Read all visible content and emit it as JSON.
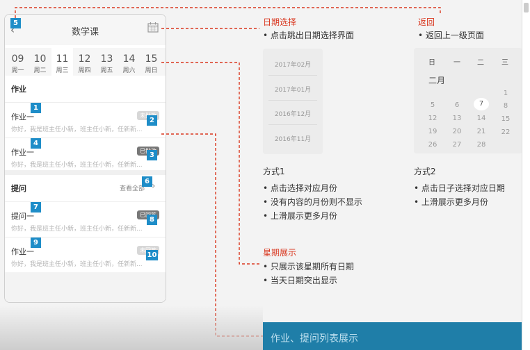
{
  "phone": {
    "back_icon": "chevron-left-icon",
    "title": "数学课",
    "calendar_icon": "calendar-icon",
    "week": [
      {
        "num": "09",
        "label": "周一"
      },
      {
        "num": "10",
        "label": "周二"
      },
      {
        "num": "11",
        "label": "周三"
      },
      {
        "num": "12",
        "label": "周四"
      },
      {
        "num": "13",
        "label": "周五"
      },
      {
        "num": "14",
        "label": "周六"
      },
      {
        "num": "15",
        "label": "周日"
      }
    ],
    "homework_header": "作业",
    "question_header": "提问",
    "see_all": "查看全部",
    "homework_items": [
      {
        "title": "作业一",
        "desc": "你好，我是班主任小新，班主任小新，任新新...",
        "badge": "未批改"
      },
      {
        "title": "作业一",
        "desc": "你好，我是班主任小新，班主任小新，任新新...",
        "badge": "已批改"
      }
    ],
    "question_items": [
      {
        "title": "提问一",
        "desc": "你好，我是班主任小新，班主任小新，任新新...",
        "badge": "已回答"
      },
      {
        "title": "作业一",
        "desc": "你好，我是班主任小新，班主任小新，任新新...",
        "badge": "未回答"
      }
    ]
  },
  "markers": [
    "1",
    "2",
    "3",
    "4",
    "5",
    "6",
    "7",
    "8",
    "9",
    "10"
  ],
  "annotations": {
    "date_select_title": "日期选择",
    "date_select_desc": "点击跳出日期选择界面",
    "back_title": "返回",
    "back_desc": "返回上一级页面",
    "months": [
      "2017年02月",
      "2017年01月",
      "2016年12月",
      "2016年11月"
    ],
    "mode1": "方式1",
    "mode1_points": [
      "点击选择对应月份",
      "没有内容的月份则不显示",
      "上滑展示更多月份"
    ],
    "mode2": "方式2",
    "mode2_points": [
      "点击日子选择对应日期",
      "上滑展示更多月份"
    ],
    "calendar_head": [
      "日",
      "一",
      "二",
      "三"
    ],
    "calendar_month": "二月",
    "calendar_rows": [
      [
        "",
        "",
        "",
        "1"
      ],
      [
        "5",
        "6",
        "7",
        "8"
      ],
      [
        "12",
        "13",
        "14",
        "15"
      ],
      [
        "19",
        "20",
        "21",
        "22"
      ],
      [
        "26",
        "27",
        "28",
        ""
      ]
    ],
    "calendar_today": "7",
    "week_title": "星期展示",
    "week_points": [
      "只展示该星期所有日期",
      "当天日期突出显示"
    ],
    "list_caption": "作业、提问列表展示",
    "accent_red": "#d9371f",
    "marker_blue": "#1e8dc8"
  }
}
